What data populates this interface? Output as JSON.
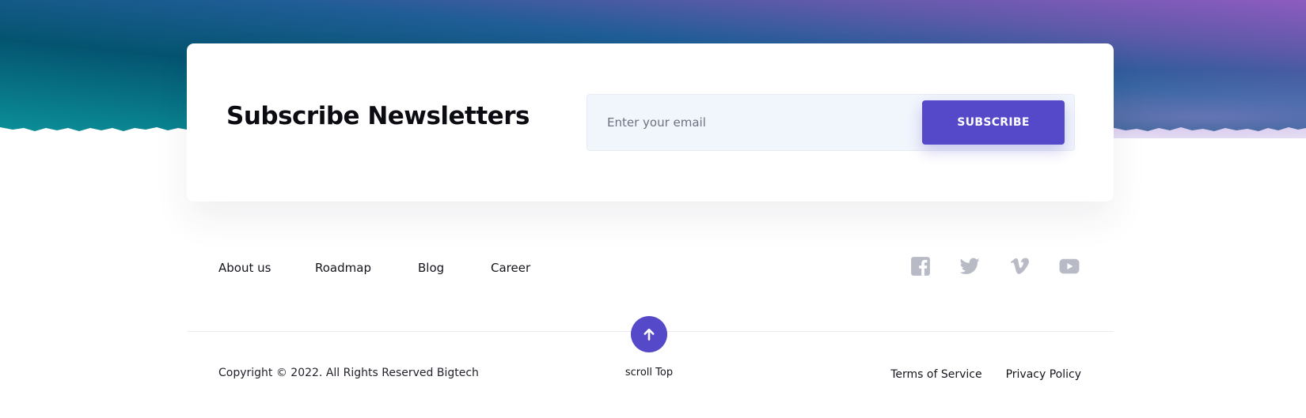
{
  "newsletter": {
    "title": "Subscribe Newsletters",
    "email_placeholder": "Enter your email",
    "button_label": "SUBSCRIBE"
  },
  "footer_nav": {
    "items": [
      {
        "label": "About us"
      },
      {
        "label": "Roadmap"
      },
      {
        "label": "Blog"
      },
      {
        "label": "Career"
      }
    ]
  },
  "social": {
    "icons": [
      "facebook-icon",
      "twitter-icon",
      "vimeo-icon",
      "youtube-icon"
    ]
  },
  "scroll_top": {
    "label": "scroll Top",
    "icon": "arrow-up-icon"
  },
  "copyright": "Copyright © 2022. All Rights Reserved Bigtech",
  "legal": {
    "terms": "Terms of Service",
    "privacy": "Privacy Policy"
  },
  "colors": {
    "accent": "#5649c9",
    "gradient_start": "#0a8a94",
    "gradient_mid": "#04506e",
    "gradient_end": "#8a58bd",
    "social_icon": "#b8bbc6",
    "input_bg": "#f1f5fc"
  }
}
